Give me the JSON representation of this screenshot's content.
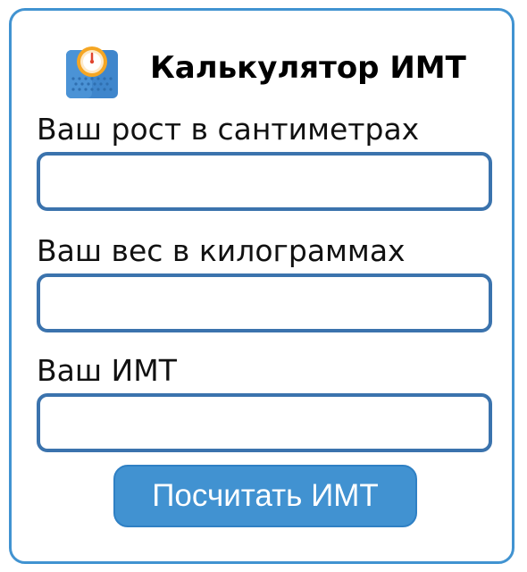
{
  "header": {
    "title": "Калькулятор ИМТ",
    "icon": "bathroom-scale-icon"
  },
  "form": {
    "height_label": "Ваш рост в сантиметрах",
    "height_value": "",
    "weight_label": "Ваш вес в килограммах",
    "weight_value": "",
    "bmi_label": "Ваш ИМТ",
    "bmi_value": ""
  },
  "actions": {
    "calculate_label": "Посчитать ИМТ"
  },
  "colors": {
    "accent": "#4193d1",
    "field_border": "#3b73ad",
    "button_bg": "#4192d1"
  }
}
